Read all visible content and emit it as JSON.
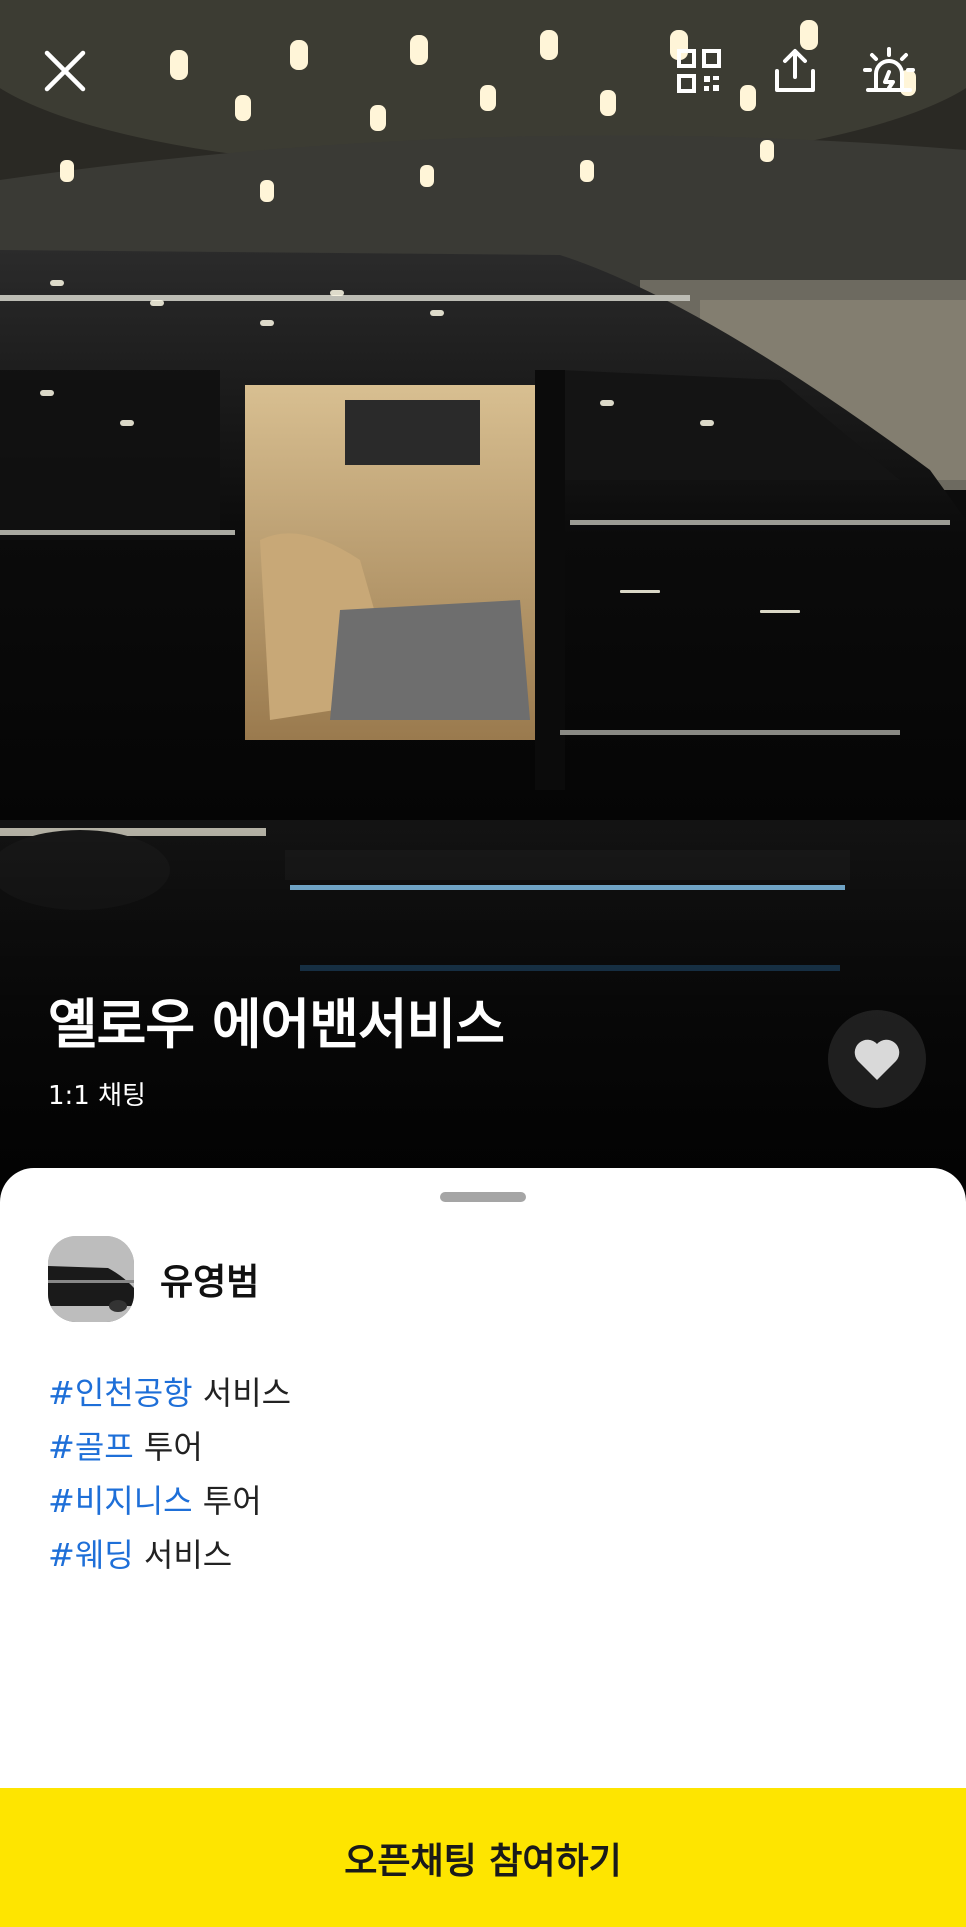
{
  "hero": {
    "title": "옐로우 에어밴서비스",
    "subtitle": "1:1 채팅",
    "icons": [
      "close-icon",
      "qr-code-icon",
      "share-icon",
      "report-siren-icon",
      "heart-icon"
    ]
  },
  "sheet": {
    "owner_name": "유영범",
    "tags": [
      {
        "hashtag": "#인천공항",
        "text": "서비스"
      },
      {
        "hashtag": "#골프",
        "text": "투어"
      },
      {
        "hashtag": "#비지니스",
        "text": "투어"
      },
      {
        "hashtag": "#웨딩",
        "text": "서비스"
      }
    ]
  },
  "join_button": {
    "label": "오픈채팅 참여하기"
  },
  "colors": {
    "accent_yellow": "#fee500",
    "hashtag_blue": "#1e6fd8",
    "sheet_bg": "#ffffff"
  }
}
